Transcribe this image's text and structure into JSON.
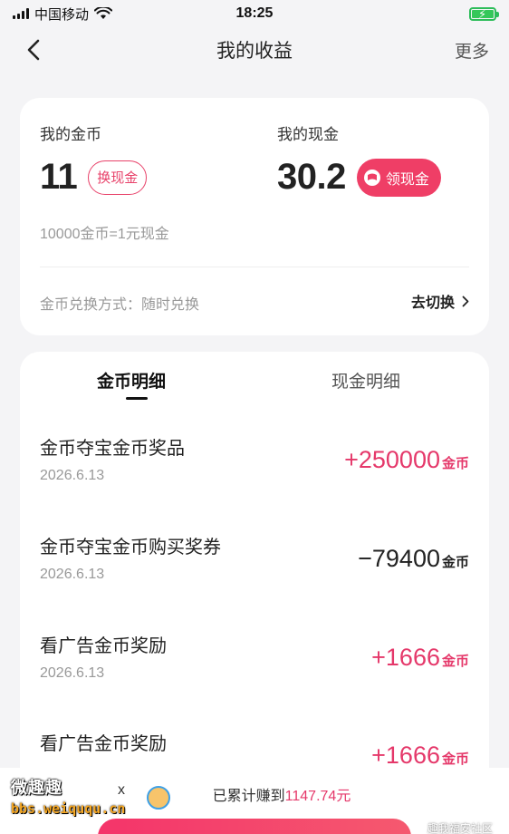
{
  "status_bar": {
    "carrier": "中国移动",
    "time": "18:25"
  },
  "nav": {
    "title": "我的收益",
    "more_label": "更多"
  },
  "balance": {
    "coins_label": "我的金币",
    "coins_value": "11",
    "exchange_label": "换现金",
    "cash_label": "我的现金",
    "cash_value": "30.2",
    "withdraw_label": "领现金",
    "rate_text": "10000金币=1元现金",
    "mode_text": "金币兑换方式：随时兑换",
    "switch_label": "去切换"
  },
  "tabs": {
    "coins_tab": "金币明细",
    "cash_tab": "现金明细"
  },
  "records": [
    {
      "title": "金币夺宝金币奖品",
      "date": "2026.6.13",
      "amount": "+250000",
      "unit": "金币"
    },
    {
      "title": "金币夺宝金币购买奖券",
      "date": "2026.6.13",
      "amount": "−79400",
      "unit": "金币"
    },
    {
      "title": "看广告金币奖励",
      "date": "2026.6.13",
      "amount": "+1666",
      "unit": "金币"
    },
    {
      "title": "看广告金币奖励",
      "date": "",
      "amount": "+1666",
      "unit": "金币"
    }
  ],
  "bottom": {
    "mark": "x",
    "summary_prefix": "已累计赚到",
    "summary_amount": "1147.74元"
  },
  "watermark": {
    "title": "微趣趣",
    "url": "bbs.weiququ.cn",
    "right_text": "趣我福安社区"
  },
  "colors": {
    "accent": "#ef3e66",
    "positive": "#e5386a",
    "background": "#f4f4f6"
  }
}
